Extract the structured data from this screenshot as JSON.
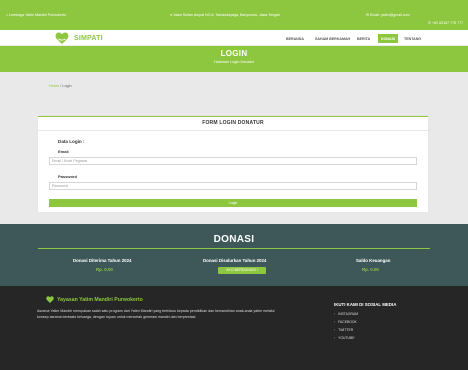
{
  "topbar": {
    "org": "Lembaga Yatim Mandiri Purwokerto",
    "address": "Jalan Sultan Ampat NO.8, Tamandayaga, Banyumas, Jawa Tengah",
    "email": "Email: yatim@gmail.com",
    "phone": "+62 83187 775 777"
  },
  "nav": {
    "logo_text": "SIMPATI",
    "items": [
      "BERANDA",
      "SAHAM BERKAMAH",
      "BERITA",
      "DONASI",
      "TENTANG"
    ],
    "active": "DONASI"
  },
  "hero": {
    "title": "LOGIN",
    "subtitle": "Halaman Login Donatur"
  },
  "breadcrumb": {
    "home": "Home",
    "sep": "/",
    "current": "Login"
  },
  "form": {
    "title": "FORM LOGIN DONATUR",
    "section": "Data Login :",
    "email_label": "Email",
    "email_placeholder": "Email / Kode Pegawai",
    "password_label": "Password",
    "password_placeholder": "Password",
    "submit": "Login"
  },
  "donasi": {
    "title": "DONASI",
    "stats": [
      {
        "label": "Donasi Diterima Tahun 2024",
        "value": "Rp. 0.00"
      },
      {
        "label": "Donasi Disalurkan Tahun 2024",
        "value": "Rp. 0.00"
      },
      {
        "label": "Saldo Keuangan",
        "value": "Rp. 0.00"
      }
    ],
    "button": "AYO BERDONASI !"
  },
  "footer": {
    "title": "Yayasan Yatim Mandiri Purwokerto",
    "desc": "Asrama Yatim Mandiri merupakan salah satu program dari Yatim Mandiri yang berfokus kepada pendidikan dan kemandirian anak-anak yatim melalui konsep asrama berbasis keluarga, dengan tujuan untuk mencetak generasi mandiri dan berprestasi",
    "social_title": "IKUTI KAMI DI SOSIAL MEDIA",
    "social": [
      "INSTAGRAM",
      "FACEBOOK",
      "TWITTER",
      "YOUTUBE"
    ]
  },
  "colors": {
    "accent": "#8dc63f",
    "dark_teal": "#3e5859",
    "footer": "#262626"
  },
  "icons": {
    "org": "home-icon",
    "address": "map-pin-icon",
    "email": "mail-icon",
    "phone": "phone-icon",
    "logo": "heart-icon",
    "social": "chevron-right-icon"
  }
}
